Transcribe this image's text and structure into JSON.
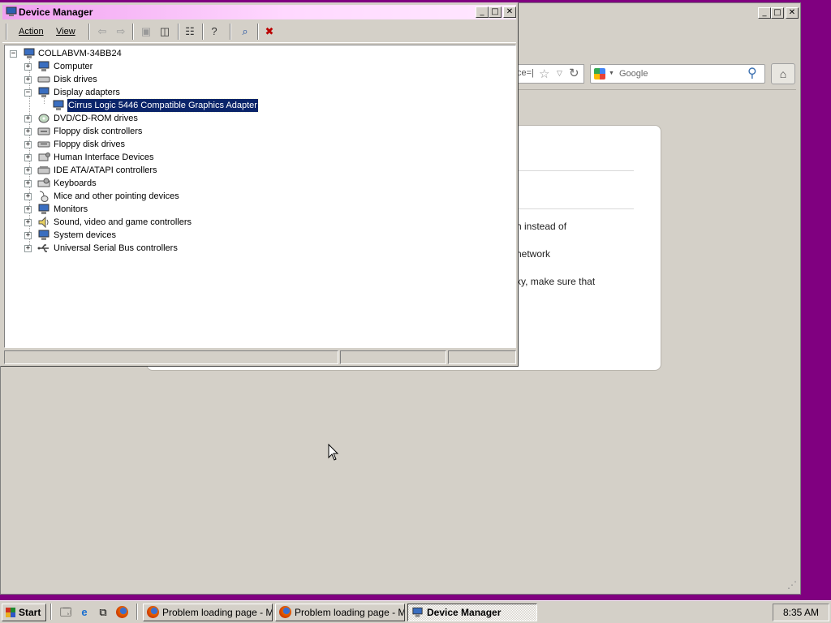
{
  "firefox": {
    "url_partial": "ce=|",
    "search_placeholder": "Google",
    "error_lines": [
      "n instead of",
      "network",
      "xy, make sure that"
    ]
  },
  "device_manager": {
    "title": "Device Manager",
    "menu": {
      "action": "Action",
      "view": "View"
    },
    "toolbar_icons": [
      "back-icon",
      "forward-icon",
      "up-icon",
      "show-hide-tree-icon",
      "properties-icon",
      "help-icon",
      "scan-hardware-icon",
      "uninstall-icon"
    ],
    "tree": {
      "root": "COLLABVM-34BB24",
      "categories": [
        {
          "label": "Computer",
          "expanded": false,
          "icon": "computer-icon"
        },
        {
          "label": "Disk drives",
          "expanded": false,
          "icon": "disk-drive-icon"
        },
        {
          "label": "Display adapters",
          "expanded": true,
          "icon": "display-adapter-icon",
          "children": [
            {
              "label": "Cirrus Logic 5446 Compatible Graphics Adapter",
              "selected": true
            }
          ]
        },
        {
          "label": "DVD/CD-ROM drives",
          "expanded": false,
          "icon": "cdrom-icon"
        },
        {
          "label": "Floppy disk controllers",
          "expanded": false,
          "icon": "floppy-controller-icon"
        },
        {
          "label": "Floppy disk drives",
          "expanded": false,
          "icon": "floppy-drive-icon"
        },
        {
          "label": "Human Interface Devices",
          "expanded": false,
          "icon": "hid-icon"
        },
        {
          "label": "IDE ATA/ATAPI controllers",
          "expanded": false,
          "icon": "ide-controller-icon"
        },
        {
          "label": "Keyboards",
          "expanded": false,
          "icon": "keyboard-icon"
        },
        {
          "label": "Mice and other pointing devices",
          "expanded": false,
          "icon": "mouse-icon"
        },
        {
          "label": "Monitors",
          "expanded": false,
          "icon": "monitor-icon"
        },
        {
          "label": "Sound, video and game controllers",
          "expanded": false,
          "icon": "sound-icon"
        },
        {
          "label": "System devices",
          "expanded": false,
          "icon": "system-devices-icon"
        },
        {
          "label": "Universal Serial Bus controllers",
          "expanded": false,
          "icon": "usb-icon"
        }
      ]
    }
  },
  "taskbar": {
    "start_label": "Start",
    "quick_launch": [
      "show-desktop-icon",
      "internet-explorer-icon",
      "network-icon",
      "firefox-icon"
    ],
    "tasks": [
      {
        "label": "Problem loading page - M...",
        "active": false
      },
      {
        "label": "Problem loading page - M...",
        "active": false
      },
      {
        "label": "Device Manager",
        "active": true
      }
    ],
    "clock": "8:35 AM"
  }
}
